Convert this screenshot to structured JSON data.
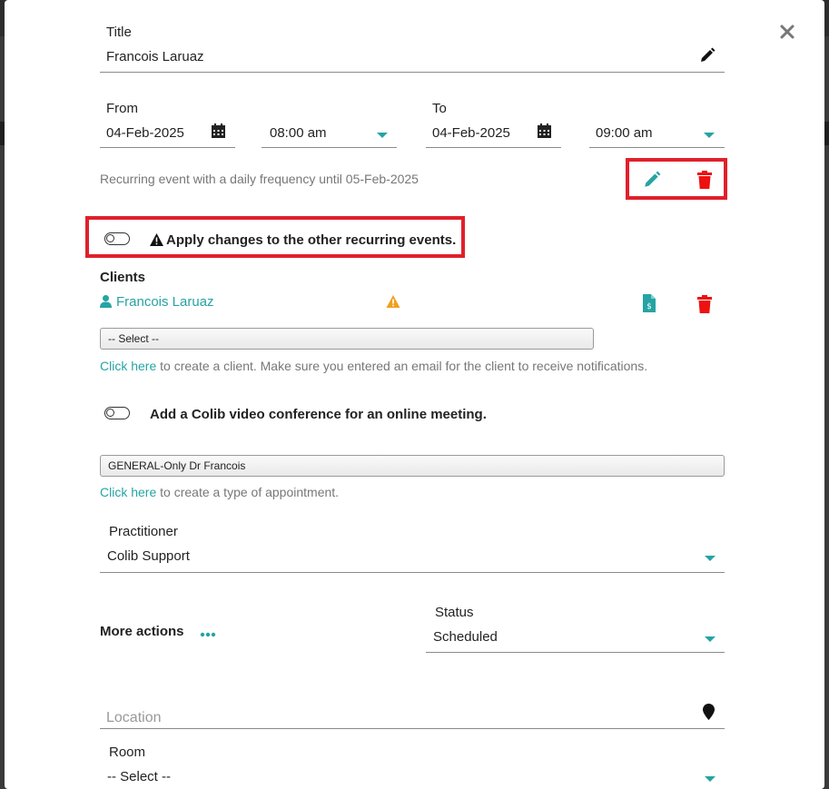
{
  "title_field": {
    "label": "Title",
    "value": "Francois Laruaz"
  },
  "from": {
    "label": "From",
    "date": "04-Feb-2025",
    "time": "08:00 am"
  },
  "to": {
    "label": "To",
    "date": "04-Feb-2025",
    "time": "09:00 am"
  },
  "recurring_text": "Recurring event with a daily frequency until 05-Feb-2025",
  "apply_changes_label": "Apply changes to the other recurring events.",
  "clients": {
    "heading": "Clients",
    "client_name": "Francois Laruaz",
    "select_placeholder": "-- Select --",
    "link_text": "Click here",
    "help_text": " to create a client. Make sure you entered an email for the client to receive notifications."
  },
  "video_label": "Add a Colib video conference for an online meeting.",
  "appointment_type": {
    "value": "GENERAL-Only Dr Francois",
    "link_text": "Click here",
    "help_text": " to create a type of appointment."
  },
  "practitioner": {
    "label": "Practitioner",
    "value": "Colib Support"
  },
  "more_actions_label": "More actions",
  "status": {
    "label": "Status",
    "value": "Scheduled"
  },
  "location": {
    "placeholder": "Location"
  },
  "room": {
    "label": "Room",
    "value": "-- Select --"
  },
  "colors": {
    "teal": "#26a3a3",
    "red": "#ee1111",
    "highlight": "#e0202b"
  }
}
